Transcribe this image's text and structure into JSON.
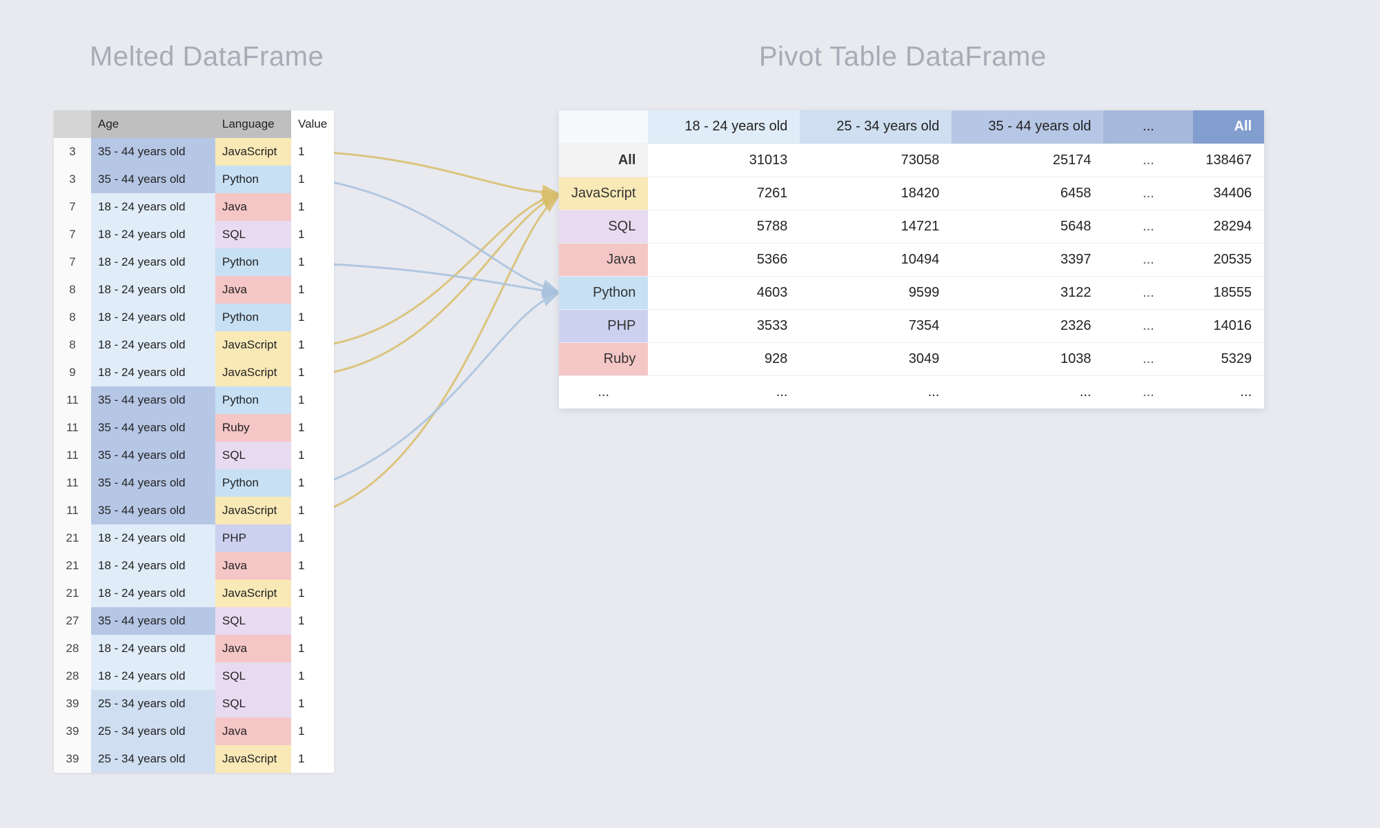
{
  "titles": {
    "left": "Melted DataFrame",
    "right": "Pivot Table DataFrame"
  },
  "ellipsis": "...",
  "melted": {
    "headers": {
      "idx": "",
      "age": "Age",
      "lang": "Language",
      "val": "Value"
    },
    "rows": [
      {
        "idx": "3",
        "age": "35 - 44 years old",
        "age_cls": "age-35",
        "lang": "JavaScript",
        "lang_cls": "lang-js",
        "val": "1"
      },
      {
        "idx": "3",
        "age": "35 - 44 years old",
        "age_cls": "age-35",
        "lang": "Python",
        "lang_cls": "lang-py",
        "val": "1"
      },
      {
        "idx": "7",
        "age": "18 - 24 years old",
        "age_cls": "age-18",
        "lang": "Java",
        "lang_cls": "lang-java",
        "val": "1"
      },
      {
        "idx": "7",
        "age": "18 - 24 years old",
        "age_cls": "age-18",
        "lang": "SQL",
        "lang_cls": "lang-sql",
        "val": "1"
      },
      {
        "idx": "7",
        "age": "18 - 24 years old",
        "age_cls": "age-18",
        "lang": "Python",
        "lang_cls": "lang-py",
        "val": "1"
      },
      {
        "idx": "8",
        "age": "18 - 24 years old",
        "age_cls": "age-18",
        "lang": "Java",
        "lang_cls": "lang-java",
        "val": "1"
      },
      {
        "idx": "8",
        "age": "18 - 24 years old",
        "age_cls": "age-18",
        "lang": "Python",
        "lang_cls": "lang-py",
        "val": "1"
      },
      {
        "idx": "8",
        "age": "18 - 24 years old",
        "age_cls": "age-18",
        "lang": "JavaScript",
        "lang_cls": "lang-js",
        "val": "1"
      },
      {
        "idx": "9",
        "age": "18 - 24 years old",
        "age_cls": "age-18",
        "lang": "JavaScript",
        "lang_cls": "lang-js",
        "val": "1"
      },
      {
        "idx": "11",
        "age": "35 - 44 years old",
        "age_cls": "age-35",
        "lang": "Python",
        "lang_cls": "lang-py",
        "val": "1"
      },
      {
        "idx": "11",
        "age": "35 - 44 years old",
        "age_cls": "age-35",
        "lang": "Ruby",
        "lang_cls": "lang-ruby",
        "val": "1"
      },
      {
        "idx": "11",
        "age": "35 - 44 years old",
        "age_cls": "age-35",
        "lang": "SQL",
        "lang_cls": "lang-sql",
        "val": "1"
      },
      {
        "idx": "11",
        "age": "35 - 44 years old",
        "age_cls": "age-35",
        "lang": "Python",
        "lang_cls": "lang-py",
        "val": "1"
      },
      {
        "idx": "11",
        "age": "35 - 44 years old",
        "age_cls": "age-35",
        "lang": "JavaScript",
        "lang_cls": "lang-js",
        "val": "1"
      },
      {
        "idx": "21",
        "age": "18 - 24 years old",
        "age_cls": "age-18",
        "lang": "PHP",
        "lang_cls": "lang-php",
        "val": "1"
      },
      {
        "idx": "21",
        "age": "18 - 24 years old",
        "age_cls": "age-18",
        "lang": "Java",
        "lang_cls": "lang-java",
        "val": "1"
      },
      {
        "idx": "21",
        "age": "18 - 24 years old",
        "age_cls": "age-18",
        "lang": "JavaScript",
        "lang_cls": "lang-js",
        "val": "1"
      },
      {
        "idx": "27",
        "age": "35 - 44 years old",
        "age_cls": "age-35",
        "lang": "SQL",
        "lang_cls": "lang-sql",
        "val": "1"
      },
      {
        "idx": "28",
        "age": "18 - 24 years old",
        "age_cls": "age-18",
        "lang": "Java",
        "lang_cls": "lang-java",
        "val": "1"
      },
      {
        "idx": "28",
        "age": "18 - 24 years old",
        "age_cls": "age-18",
        "lang": "SQL",
        "lang_cls": "lang-sql",
        "val": "1"
      },
      {
        "idx": "39",
        "age": "25 - 34 years old",
        "age_cls": "age-25",
        "lang": "SQL",
        "lang_cls": "lang-sql",
        "val": "1"
      },
      {
        "idx": "39",
        "age": "25 - 34 years old",
        "age_cls": "age-25",
        "lang": "Java",
        "lang_cls": "lang-java",
        "val": "1"
      },
      {
        "idx": "39",
        "age": "25 - 34 years old",
        "age_cls": "age-25",
        "lang": "JavaScript",
        "lang_cls": "lang-js",
        "val": "1"
      }
    ]
  },
  "pivot": {
    "col_headers": [
      "18 - 24 years old",
      "25 - 34 years old",
      "35 - 44 years old",
      "...",
      "All"
    ],
    "rows": [
      {
        "name": "All",
        "cls": "rowhdr-all",
        "c1": "31013",
        "c2": "73058",
        "c3": "25174",
        "dots": "...",
        "all": "138467"
      },
      {
        "name": "JavaScript",
        "cls": "rowhdr-js",
        "c1": "7261",
        "c2": "18420",
        "c3": "6458",
        "dots": "...",
        "all": "34406"
      },
      {
        "name": "SQL",
        "cls": "rowhdr-sql",
        "c1": "5788",
        "c2": "14721",
        "c3": "5648",
        "dots": "...",
        "all": "28294"
      },
      {
        "name": "Java",
        "cls": "rowhdr-java",
        "c1": "5366",
        "c2": "10494",
        "c3": "3397",
        "dots": "...",
        "all": "20535"
      },
      {
        "name": "Python",
        "cls": "rowhdr-py",
        "c1": "4603",
        "c2": "9599",
        "c3": "3122",
        "dots": "...",
        "all": "18555"
      },
      {
        "name": "PHP",
        "cls": "rowhdr-php",
        "c1": "3533",
        "c2": "7354",
        "c3": "2326",
        "dots": "...",
        "all": "14016"
      },
      {
        "name": "Ruby",
        "cls": "rowhdr-ruby",
        "c1": "928",
        "c2": "3049",
        "c3": "1038",
        "dots": "...",
        "all": "5329"
      },
      {
        "name": "...",
        "cls": "rowhdr-dots",
        "c1": "...",
        "c2": "...",
        "c3": "...",
        "dots": "...",
        "all": "..."
      }
    ]
  },
  "chart_data": {
    "type": "table",
    "title": "Pivot Table DataFrame — count of Value by Age bucket × Language",
    "categories": [
      "18 - 24 years old",
      "25 - 34 years old",
      "35 - 44 years old",
      "All"
    ],
    "series": [
      {
        "name": "All",
        "values": [
          31013,
          73058,
          25174,
          138467
        ]
      },
      {
        "name": "JavaScript",
        "values": [
          7261,
          18420,
          6458,
          34406
        ]
      },
      {
        "name": "SQL",
        "values": [
          5788,
          14721,
          5648,
          28294
        ]
      },
      {
        "name": "Java",
        "values": [
          5366,
          10494,
          3397,
          20535
        ]
      },
      {
        "name": "Python",
        "values": [
          4603,
          9599,
          3122,
          18555
        ]
      },
      {
        "name": "PHP",
        "values": [
          3533,
          7354,
          2326,
          14016
        ]
      },
      {
        "name": "Ruby",
        "values": [
          928,
          3049,
          1038,
          5329
        ]
      }
    ]
  },
  "colors": {
    "age": {
      "18-24": "#e0ecf7",
      "25-34": "#cfdef1",
      "35-44": "#b6c7e6"
    },
    "lang": {
      "JavaScript": "#f9e9b7",
      "Python": "#c7e0f4",
      "Java": "#f5c6c6",
      "SQL": "#e8daf0",
      "Ruby": "#f5c6c6",
      "PHP": "#cdd1f0"
    },
    "arrow_js": "#d9be6b",
    "arrow_py": "#a9c2de"
  }
}
